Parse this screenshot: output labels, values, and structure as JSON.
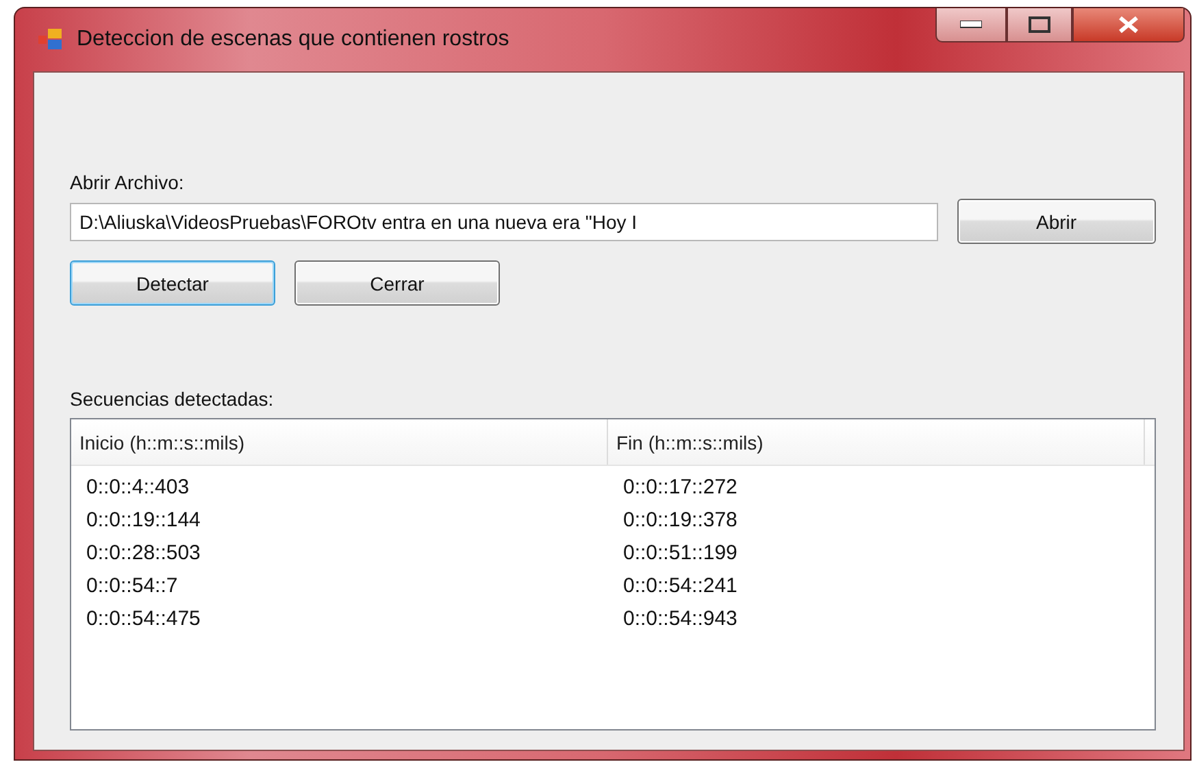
{
  "window": {
    "title": "Deteccion de escenas que contienen rostros"
  },
  "file": {
    "label": "Abrir Archivo:",
    "value": "D:\\Aliuska\\VideosPruebas\\FOROtv entra en una nueva era \"Hoy I",
    "button": "Abrir"
  },
  "buttons": [
    {
      "label": "Detectar",
      "focused": true
    },
    {
      "label": "Cerrar",
      "focused": false
    }
  ],
  "list": {
    "label": "Secuencias detectadas:",
    "columns": [
      "Inicio (h::m::s::mils)",
      "Fin (h::m::s::mils)"
    ],
    "rows": [
      [
        "0::0::4::403",
        "0::0::17::272"
      ],
      [
        "0::0::19::144",
        "0::0::19::378"
      ],
      [
        "0::0::28::503",
        "0::0::51::199"
      ],
      [
        "0::0::54::7",
        "0::0::54::241"
      ],
      [
        "0::0::54::475",
        "0::0::54::943"
      ]
    ]
  }
}
